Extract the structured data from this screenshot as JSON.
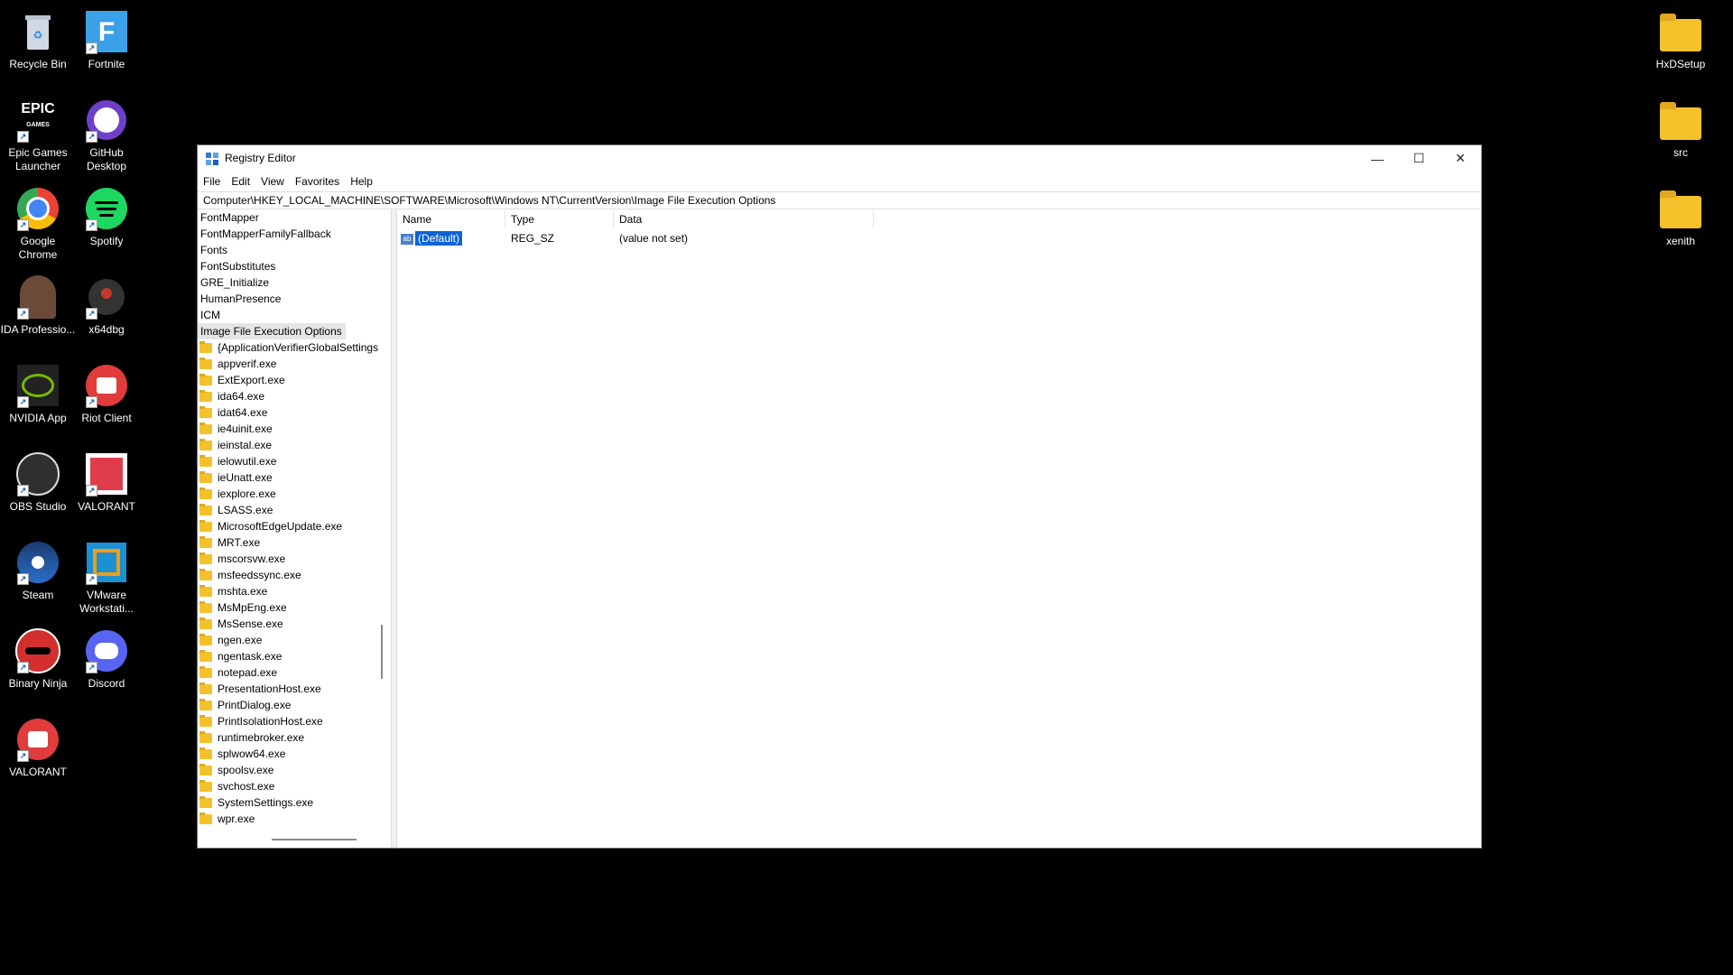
{
  "desktop": {
    "left_icons": [
      {
        "label": "Recycle Bin",
        "icon": "recycle-bin-icon"
      },
      {
        "label": "Fortnite",
        "icon": "fortnite-icon"
      },
      {
        "label": "Epic Games Launcher",
        "icon": "epic-games-icon"
      },
      {
        "label": "GitHub Desktop",
        "icon": "github-icon"
      },
      {
        "label": "Google Chrome",
        "icon": "chrome-icon"
      },
      {
        "label": "Spotify",
        "icon": "spotify-icon"
      },
      {
        "label": "IDA Professio...",
        "icon": "ida-icon"
      },
      {
        "label": "x64dbg",
        "icon": "x64dbg-icon"
      },
      {
        "label": "NVIDIA App",
        "icon": "nvidia-icon"
      },
      {
        "label": "Riot Client",
        "icon": "riot-client-icon"
      },
      {
        "label": "OBS Studio",
        "icon": "obs-icon"
      },
      {
        "label": "VALORANT",
        "icon": "valorant-icon"
      },
      {
        "label": "Steam",
        "icon": "steam-icon"
      },
      {
        "label": "VMware Workstati...",
        "icon": "vmware-icon"
      },
      {
        "label": "Binary Ninja",
        "icon": "binary-ninja-icon"
      },
      {
        "label": "Discord",
        "icon": "discord-icon"
      },
      {
        "label": "VALORANT",
        "icon": "valorant-riot-icon"
      }
    ],
    "right_icons": [
      {
        "label": "HxDSetup"
      },
      {
        "label": "src"
      },
      {
        "label": "xenith"
      }
    ]
  },
  "window": {
    "title": "Registry Editor",
    "minimize": "—",
    "maximize": "☐",
    "close": "✕",
    "menu": [
      "File",
      "Edit",
      "View",
      "Favorites",
      "Help"
    ],
    "address": "Computer\\HKEY_LOCAL_MACHINE\\SOFTWARE\\Microsoft\\Windows NT\\CurrentVersion\\Image File Execution Options"
  },
  "tree": {
    "parents": [
      "FontMapper",
      "FontMapperFamilyFallback",
      "Fonts",
      "FontSubstitutes",
      "GRE_Initialize",
      "HumanPresence",
      "ICM"
    ],
    "selected": "Image File Execution Options",
    "children": [
      "{ApplicationVerifierGlobalSettings",
      "appverif.exe",
      "ExtExport.exe",
      "ida64.exe",
      "idat64.exe",
      "ie4uinit.exe",
      "ieinstal.exe",
      "ielowutil.exe",
      "ieUnatt.exe",
      "iexplore.exe",
      "LSASS.exe",
      "MicrosoftEdgeUpdate.exe",
      "MRT.exe",
      "mscorsvw.exe",
      "msfeedssync.exe",
      "mshta.exe",
      "MsMpEng.exe",
      "MsSense.exe",
      "ngen.exe",
      "ngentask.exe",
      "notepad.exe",
      "PresentationHost.exe",
      "PrintDialog.exe",
      "PrintIsolationHost.exe",
      "runtimebroker.exe",
      "splwow64.exe",
      "spoolsv.exe",
      "svchost.exe",
      "SystemSettings.exe",
      "wpr.exe"
    ]
  },
  "values": {
    "headers": [
      "Name",
      "Type",
      "Data"
    ],
    "rows": [
      {
        "name": "(Default)",
        "type": "REG_SZ",
        "data": "(value not set)",
        "icon_text": "ab"
      }
    ]
  }
}
